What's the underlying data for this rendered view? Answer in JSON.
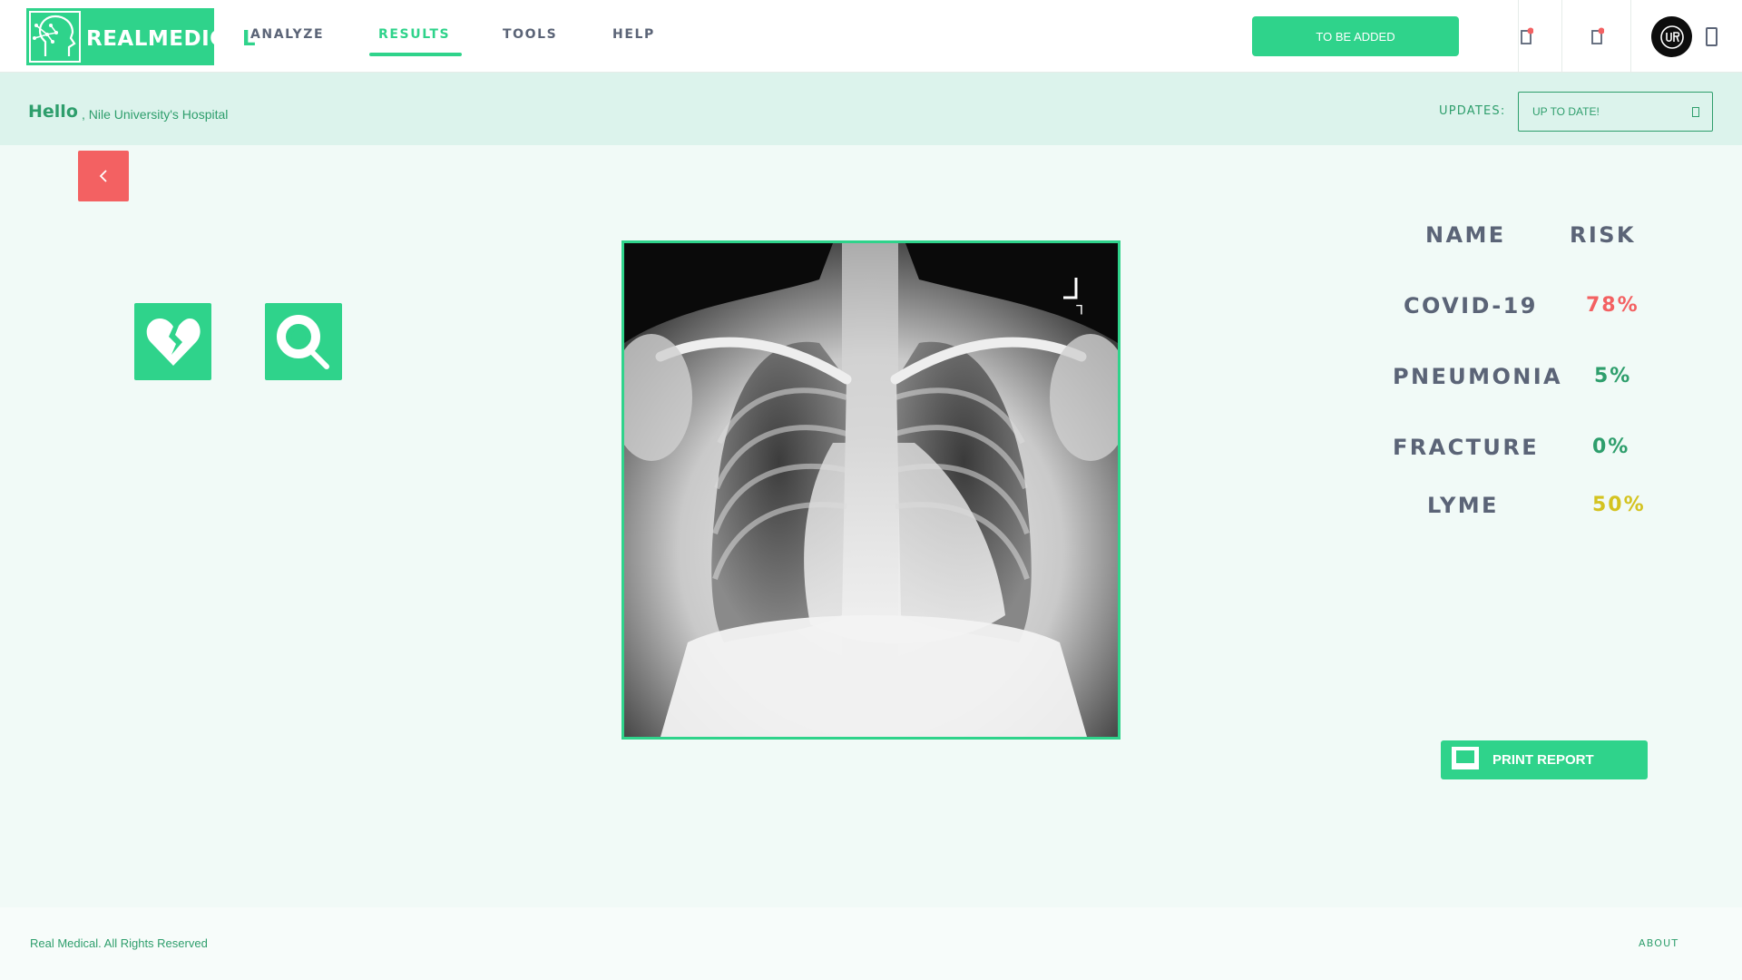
{
  "header": {
    "logo_text_main": "REALMEDICA",
    "logo_text_tail": "L",
    "nav": [
      {
        "label": "ANALYZE",
        "active": false
      },
      {
        "label": "RESULTS",
        "active": true
      },
      {
        "label": "TOOLS",
        "active": false
      },
      {
        "label": "HELP",
        "active": false
      }
    ],
    "action_button_label": "TO BE ADDED",
    "accent_color": "#2fd38b"
  },
  "greeting": {
    "hello": "Hello",
    "hospital": ", Nile University's Hospital",
    "updates_label": "UPDATES:",
    "updates_value": "UP TO DATE!"
  },
  "main": {
    "back_icon": "chevron-left-icon",
    "tools": [
      {
        "name": "heart-icon"
      },
      {
        "name": "magnifier-icon"
      }
    ],
    "xray_corner_marker": "L"
  },
  "results": {
    "headers": {
      "name": "NAME",
      "risk": "RISK"
    },
    "rows": [
      {
        "name": "COVID-19",
        "risk": "78%",
        "color": "#f36162"
      },
      {
        "name": "PNEUMONIA",
        "risk": "5%",
        "color": "#2e9e6c"
      },
      {
        "name": "FRACTURE",
        "risk": "0%",
        "color": "#2e9e6c"
      },
      {
        "name": "LYME",
        "risk": "50%",
        "color": "#d4c320"
      }
    ],
    "print_label": "PRINT REPORT"
  },
  "footer": {
    "copyright": "Real Medical. All Rights Reserved",
    "about": "ABOUT"
  }
}
